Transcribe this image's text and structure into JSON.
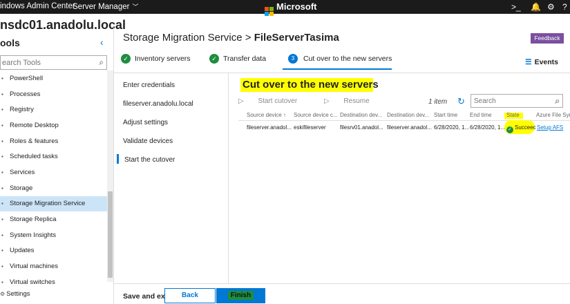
{
  "topbar": {
    "app_name": "indows Admin Center",
    "server_manager": "Server Manager",
    "brand": "Microsoft"
  },
  "server": {
    "name": "nsdc01.anadolu.local"
  },
  "tools": {
    "label": "ools",
    "search_placeholder": "earch Tools",
    "items": [
      "PowerShell",
      "Processes",
      "Registry",
      "Remote Desktop",
      "Roles & features",
      "Scheduled tasks",
      "Services",
      "Storage",
      "Storage Migration Service",
      "Storage Replica",
      "System Insights",
      "Updates",
      "Virtual machines",
      "Virtual switches"
    ],
    "settings": "Settings"
  },
  "breadcrumb": {
    "parent": "Storage Migration Service",
    "sep": ">",
    "current": "FileServerTasima"
  },
  "feedback": "Feedback",
  "steps": {
    "step1": "Inventory servers",
    "step2": "Transfer data",
    "step3_num": "3",
    "step3": "Cut over to the new servers",
    "events": "Events"
  },
  "substeps": [
    "Enter credentials",
    "fileserver.anadolu.local",
    "Adjust settings",
    "Validate devices",
    "Start the cutover"
  ],
  "main": {
    "heading": "Cut over to the new servers",
    "start_cutover": "Start cutover",
    "resume": "Resume",
    "count": "1 item",
    "search_placeholder": "Search"
  },
  "table": {
    "headers": [
      "Source device ↑",
      "Source device c...",
      "Destination dev...",
      "Destination dev...",
      "Start time",
      "End time",
      "State",
      "Azure File Sync"
    ],
    "row": [
      "fileserver.anadol...",
      "eskifileserver",
      "filesrv01.anadol...",
      "fileserver.anadol...",
      "6/28/2020, 1...",
      "6/28/2020, 1...",
      "Succeec",
      "Setup AFS"
    ]
  },
  "footer": {
    "save_exit": "Save and exit",
    "back": "Back",
    "finish": "Finish"
  },
  "colors": {
    "accent": "#0078d4",
    "success": "#1e8e3e",
    "highlight": "#ffff00",
    "feedback": "#7a4fa0"
  }
}
